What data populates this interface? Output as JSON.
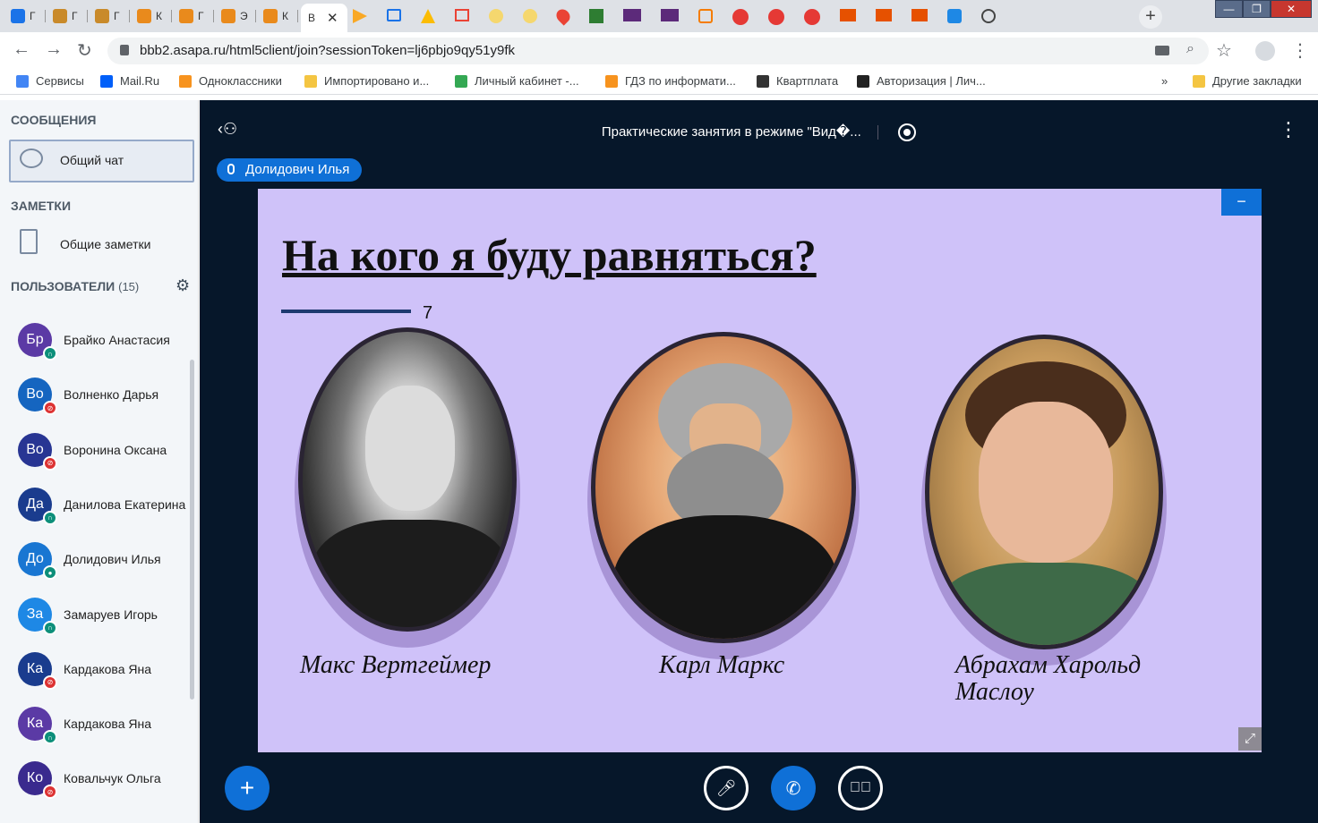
{
  "browser": {
    "active_tab_title": "В",
    "url": "bbb2.asapa.ru/html5client/join?sessionToken=lj6pbjo9qy51y9fk",
    "tabs": [
      {
        "icon": "mail-icon",
        "color": "#1a73e8",
        "label": "Г"
      },
      {
        "icon": "owl-icon",
        "color": "#c98a2a",
        "label": "Г"
      },
      {
        "icon": "owl-icon",
        "color": "#c98a2a",
        "label": "Г"
      },
      {
        "icon": "brand-m-icon",
        "color": "#e98a1c",
        "label": "К"
      },
      {
        "icon": "brand-m-icon",
        "color": "#e98a1c",
        "label": "Г"
      },
      {
        "icon": "brand-m-icon",
        "color": "#e98a1c",
        "label": "Э"
      },
      {
        "icon": "brand-m-icon",
        "color": "#e98a1c",
        "label": "К"
      }
    ],
    "bookmarks": [
      {
        "label": "Сервисы",
        "color": "#4285f4"
      },
      {
        "label": "Mail.Ru",
        "color": "#005ff9"
      },
      {
        "label": "Одноклассники",
        "color": "#f7931e"
      },
      {
        "label": "Импортировано и...",
        "color": "#f4c542"
      },
      {
        "label": "Личный кабинет -...",
        "color": "#34a853"
      },
      {
        "label": "ГДЗ по информати...",
        "color": "#f7931e"
      },
      {
        "label": "Квартплата",
        "color": "#333333"
      },
      {
        "label": "Авторизация | Лич...",
        "color": "#222222"
      }
    ],
    "more_bookmarks": "»",
    "other_bookmarks": "Другие закладки"
  },
  "sidebar": {
    "messages_header": "СООБЩЕНИЯ",
    "public_chat": "Общий чат",
    "notes_header": "ЗАМЕТКИ",
    "shared_notes": "Общие заметки",
    "users_header": "ПОЛЬЗОВАТЕЛИ",
    "users_count": "(15)",
    "users": [
      {
        "initials": "Бр",
        "name": "Брайко Анастасия",
        "color": "#5b3aa5",
        "status": "listen"
      },
      {
        "initials": "Во",
        "name": "Волненко Дарья",
        "color": "#1565c0",
        "status": "muted"
      },
      {
        "initials": "Во",
        "name": "Воронина Оксана",
        "color": "#283593",
        "status": "muted"
      },
      {
        "initials": "Да",
        "name": "Данилова Екатерина",
        "color": "#1a3c8e",
        "status": "listen"
      },
      {
        "initials": "До",
        "name": "Долидович Илья",
        "color": "#1976d2",
        "status": "talking"
      },
      {
        "initials": "За",
        "name": "Замаруев Игорь",
        "color": "#1e88e5",
        "status": "listen"
      },
      {
        "initials": "Ка",
        "name": "Кардакова Яна",
        "color": "#1a3c8e",
        "status": "muted"
      },
      {
        "initials": "Ка",
        "name": "Кардакова Яна",
        "color": "#5b3aa5",
        "status": "listen"
      },
      {
        "initials": "Ко",
        "name": "Ковальчук Ольга",
        "color": "#3a2a8e",
        "status": "muted"
      }
    ]
  },
  "meeting": {
    "title": "Практические занятия в режиме \"Вид�...",
    "talking_user": "Долидович Илья"
  },
  "slide": {
    "title": "На кого я буду равняться? ",
    "number": "7",
    "people": [
      {
        "name": "Макс Вертгеймер"
      },
      {
        "name": "Карл Маркс"
      },
      {
        "name": "Абрахам Харольд Маслоу"
      }
    ]
  },
  "colors": {
    "accent": "#0f70d7",
    "slide_bg": "#cfc2f9",
    "app_bg": "#06172a"
  }
}
